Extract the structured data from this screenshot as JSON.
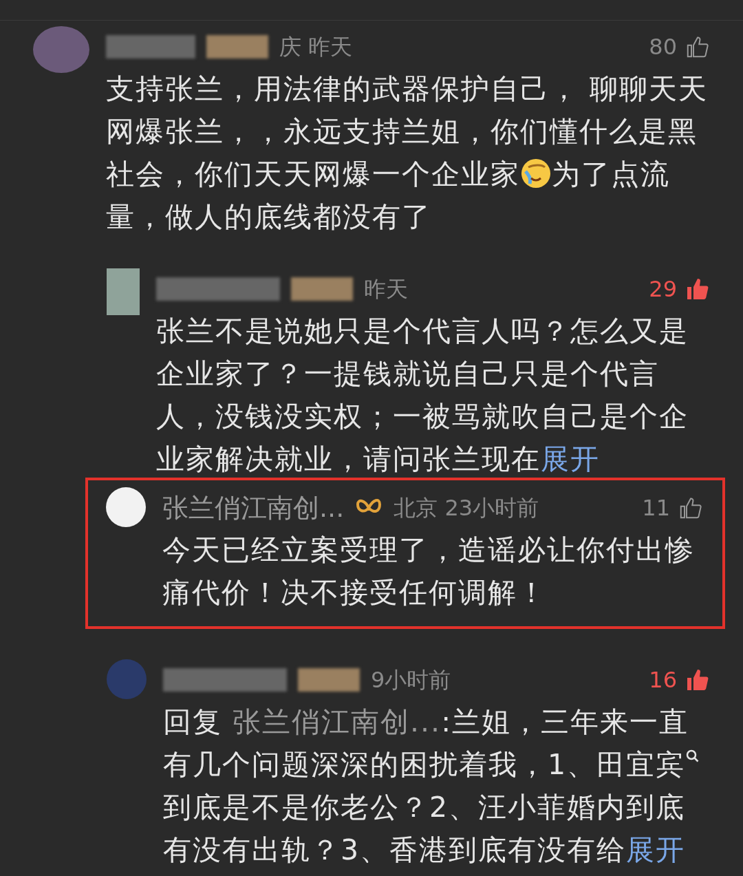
{
  "comments": [
    {
      "kind": "top",
      "meta": "庆 昨天",
      "likes": "80",
      "liked": false,
      "verified": false,
      "highlighted": false,
      "body": [
        {
          "kind": "plain",
          "text": "支持张兰，用法律的武器保护自己， 聊聊天天网爆张兰，，永远支持兰姐，你们懂什么是黑社会，你们天天网爆一个企业家"
        },
        {
          "kind": "emoji"
        },
        {
          "kind": "plain",
          "text": "为了点流量，做人的底线都没有了"
        }
      ]
    },
    {
      "kind": "reply",
      "meta": "昨天",
      "likes": "29",
      "liked": true,
      "verified": false,
      "highlighted": false,
      "body": [
        {
          "kind": "plain",
          "text": "张兰不是说她只是个代言人吗？怎么又是企业家了？一提钱就说自己只是个代言人，没钱没实权；一被骂就吹自己是个企业家解决就业，请问张兰现在"
        }
      ],
      "expand": "展开"
    },
    {
      "kind": "reply",
      "meta": "北京 23小时前",
      "likes": "11",
      "liked": false,
      "verified": true,
      "highlighted": true,
      "name": "张兰俏江南创...",
      "body": [
        {
          "kind": "plain",
          "text": "今天已经立案受理了，造谣必让你付出惨痛代价！决不接受任何调解！"
        }
      ]
    },
    {
      "kind": "reply",
      "meta": "9小时前",
      "likes": "16",
      "liked": true,
      "verified": false,
      "highlighted": false,
      "body": [
        {
          "kind": "plain",
          "text": "回复 "
        },
        {
          "kind": "mention",
          "text": "张兰俏江南创..."
        },
        {
          "kind": "plain",
          "text": ":兰姐，三年来一直有几个问题深深的困扰着我，1、"
        },
        {
          "kind": "topic",
          "text": "田宜宾"
        },
        {
          "kind": "plain",
          "text": "到底是不是你老公？2、汪小菲婚内到底有没有出轨？3、香港到底有没有给"
        }
      ],
      "expand": "展开"
    }
  ]
}
